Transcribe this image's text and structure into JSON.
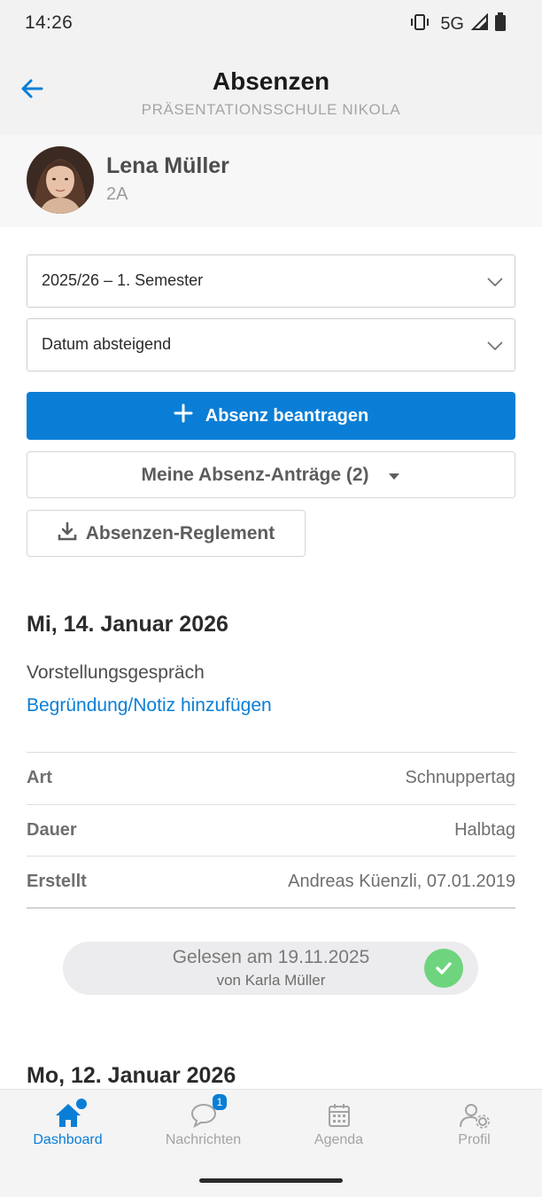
{
  "status_bar": {
    "time": "14:26",
    "network": "5G",
    "icons": [
      "vibrate-icon",
      "signal-icon",
      "battery-icon"
    ]
  },
  "header": {
    "title": "Absenzen",
    "subtitle": "PRÄSENTATIONSSCHULE NIKOLA",
    "back_icon": "arrow-left-icon"
  },
  "profile": {
    "name": "Lena Müller",
    "class": "2A"
  },
  "filters": {
    "period": "2025/26 – 1. Semester",
    "sort": "Datum absteigend"
  },
  "actions": {
    "request_absence": "Absenz beantragen",
    "my_requests": "Meine Absenz-Anträge (2)",
    "regulations": "Absenzen-Reglement"
  },
  "absences": [
    {
      "date": "Mi, 14. Januar 2026",
      "reason": "Vorstellungsgespräch",
      "note_link": "Begründung/Notiz hinzufügen",
      "details": [
        {
          "label": "Art",
          "value": "Schnuppertag"
        },
        {
          "label": "Dauer",
          "value": "Halbtag"
        },
        {
          "label": "Erstellt",
          "value": "Andreas Küenzli, 07.01.2019"
        }
      ],
      "read_status": {
        "main": "Gelesen am 19.11.2025",
        "sub": "von Karla Müller"
      }
    },
    {
      "date": "Mo, 12. Januar 2026"
    }
  ],
  "tabbar": {
    "items": [
      {
        "label": "Dashboard",
        "icon": "home-icon",
        "active": true
      },
      {
        "label": "Nachrichten",
        "icon": "chat-icon",
        "badge": "1"
      },
      {
        "label": "Agenda",
        "icon": "calendar-icon"
      },
      {
        "label": "Profil",
        "icon": "user-settings-icon"
      }
    ]
  },
  "colors": {
    "accent": "#0a7ed6",
    "success": "#6fd47e",
    "header_bg": "#f2f2f3"
  }
}
